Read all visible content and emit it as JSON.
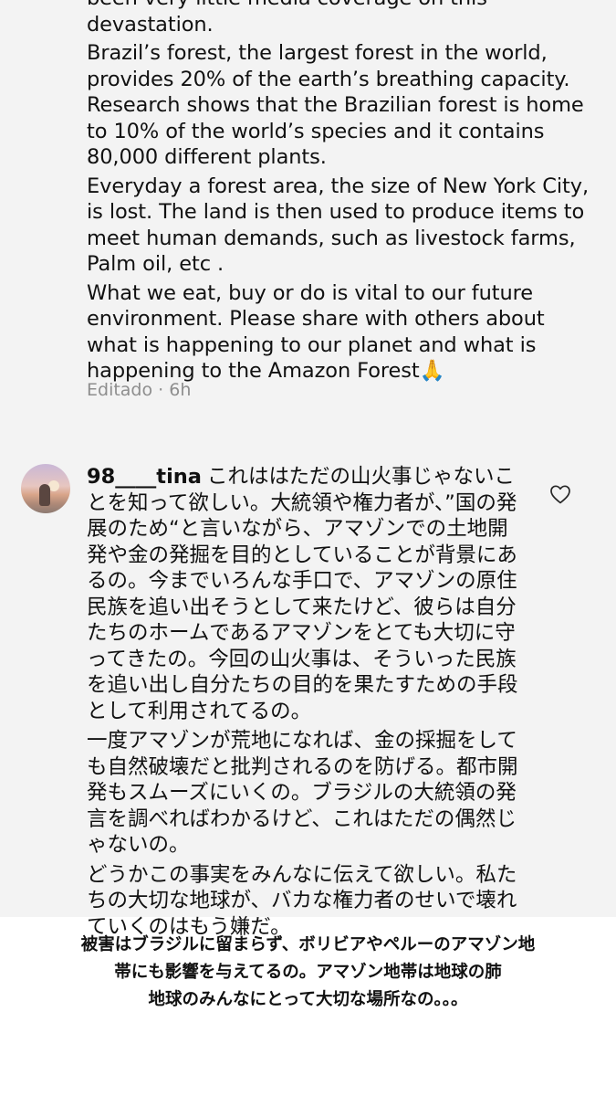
{
  "post": {
    "paragraphs": [
      "been very little media coverage on this devastation.",
      "Brazil’s forest, the largest forest in the world, provides 20% of the earth’s breathing capacity. Research shows that the Brazilian forest is home to 10% of the world’s species and it contains 80,000 different plants.",
      "Everyday a forest area, the size of New York City, is lost. The land is then used to produce items to meet human demands, such as livestock farms, Palm oil, etc .",
      "What we eat, buy or do is vital to our future environment. Please share with others about what is happening to our planet and what is happening to the Amazon Forest🙏"
    ],
    "meta": "Editado · 6h"
  },
  "comment": {
    "username": "98____tina",
    "paragraphs": [
      "これははただの山火事じゃないことを知って欲しい。大統領や権力者が、”国の発展のため“と言いながら、アマゾンでの土地開発や金の発掘を目的としていることが背景にあるの。今までいろんな手口で、アマゾンの原住民族を追い出そうとして来たけど、彼らは自分たちのホームであるアマゾンをとても大切に守ってきたの。今回の山火事は、そういった民族を追い出し自分たちの目的を果たすための手段として利用されてるの。",
      "一度アマゾンが荒地になれば、金の採掘をしても自然破壊だと批判されるのを防げる。都市開発もスムーズにいくの。ブラジルの大統領の発言を調べればわかるけど、これはただの偶然じゃないの。",
      "どうかこの事実をみんなに伝えて欲しい。私たちの大切な地球が、バカな権力者のせいで壊れていくのはもう嫌だ。"
    ],
    "like_icon": "heart-outline-icon"
  },
  "caption": {
    "lines": [
      "被害はブラジルに留まらず、ボリビアやペルーのアマゾン地",
      "帯にも影響を与えてるの。アマゾン地帯は地球の肺",
      "地球のみんなにとって大切な場所なの。。。"
    ]
  },
  "colors": {
    "card_background": "#f3f3f3",
    "page_background": "#ffffff",
    "meta_text": "#8e8e8e",
    "text": "#111111"
  }
}
